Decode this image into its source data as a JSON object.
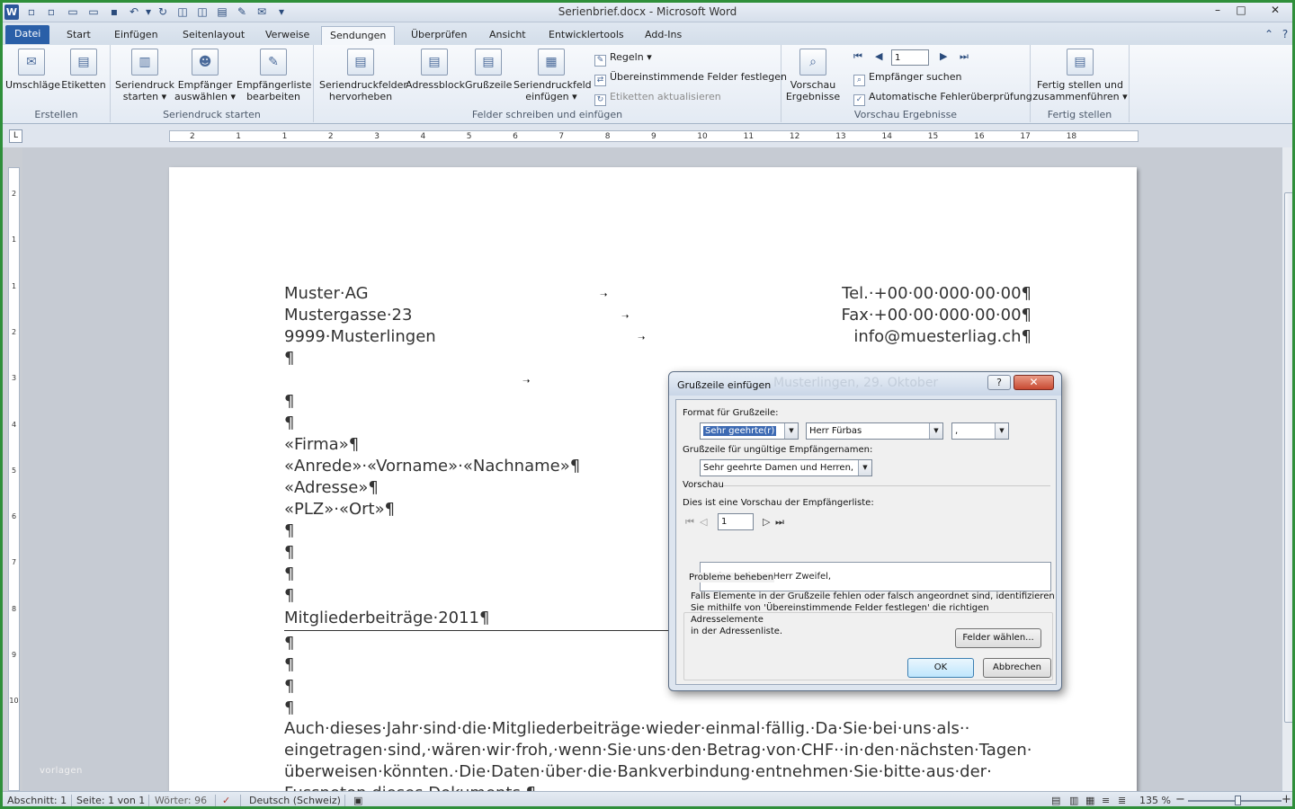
{
  "titlebar": {
    "title": "Serienbrief.docx - Microsoft Word",
    "minimize": "–",
    "maximize": "□",
    "close": "✕"
  },
  "tabs": [
    "Datei",
    "Start",
    "Einfügen",
    "Seitenlayout",
    "Verweise",
    "Sendungen",
    "Überprüfen",
    "Ansicht",
    "Entwicklertools",
    "Add-Ins"
  ],
  "active_tab": "Sendungen",
  "ribbon": {
    "groups": {
      "erstellen": "Erstellen",
      "seriendruck": "Seriendruck starten",
      "felder": "Felder schreiben und einfügen",
      "vorschau": "Vorschau Ergebnisse",
      "fertig": "Fertig stellen"
    },
    "buttons": {
      "umschlaege": "Umschläge",
      "etiketten": "Etiketten",
      "seriendruck_1": "Seriendruck",
      "seriendruck_2": "starten ▾",
      "empfaenger_1": "Empfänger",
      "empfaenger_2": "auswählen ▾",
      "liste_1": "Empfängerliste",
      "liste_2": "bearbeiten",
      "hervor_1": "Seriendruckfelder",
      "hervor_2": "hervorheben",
      "adressblock": "Adressblock",
      "gruss": "Grußzeile",
      "feld_1": "Seriendruckfeld",
      "feld_2": "einfügen ▾",
      "regeln": "Regeln ▾",
      "uebereinstimmende": "Übereinstimmende Felder festlegen",
      "etiketten_akt": "Etiketten aktualisieren",
      "vorschau_1": "Vorschau",
      "vorschau_2": "Ergebnisse",
      "record": "1",
      "empf_suchen": "Empfänger suchen",
      "fehler": "Automatische Fehlerüberprüfung",
      "fertig_1": "Fertig stellen und",
      "fertig_2": "zusammenführen ▾"
    }
  },
  "document": {
    "sender": [
      "Muster·AG",
      "Mustergasse·23",
      "9999·Musterlingen"
    ],
    "contact": [
      "Tel.·+00·00·000·00·00¶",
      "Fax·+00·00·000·00·00¶",
      "info@muesterliag.ch¶"
    ],
    "pilcrow": "¶",
    "fields": [
      "«Firma»¶",
      "«Anrede»·«Vorname»·«Nachname»¶",
      "«Adresse»¶",
      "«PLZ»·«Ort»¶"
    ],
    "subject": "Mitgliederbeiträge·2011¶",
    "body": [
      "Auch·dieses·Jahr·sind·die·Mitgliederbeiträge·wieder·einmal·fällig.·Da·Sie·bei·uns·als··",
      "eingetragen·sind,·wären·wir·froh,·wenn·Sie·uns·den·Betrag·von·CHF··in·den·nächsten·Tagen·",
      "überweisen·könnten.·Die·Daten·über·die·Bankverbindung·entnehmen·Sie·bitte·aus·der·",
      "Fussnoten·dieses·Dokuments.¶"
    ]
  },
  "watermark": "vorlagen",
  "dialog": {
    "title": "Grußzeile einfügen",
    "bg_text": "Musterlingen, 29. Oktober",
    "help": "?",
    "close": "✕",
    "format_label": "Format für Grußzeile:",
    "salutation": "Sehr geehrte(r)",
    "name_format": "Herr Fürbas",
    "punctuation": ",",
    "invalid_label": "Grußzeile für ungültige Empfängernamen:",
    "invalid_value": "Sehr geehrte Damen und Herren,",
    "preview_header": "Vorschau",
    "preview_label": "Dies ist eine Vorschau der Empfängerliste:",
    "preview_record": "1",
    "preview_text": "Sehr geehrter Herr Zweifel,",
    "problems_header": "Probleme beheben",
    "problems_text": "Falls Elemente in der Grußzeile fehlen oder falsch angeordnet sind, identifizieren\nSie mithilfe von 'Übereinstimmende Felder festlegen' die richtigen Adresselemente\nin der Adressenliste.",
    "match_fields": "Felder wählen...",
    "ok": "OK",
    "cancel": "Abbrechen"
  },
  "status": {
    "section": "Abschnitt: 1",
    "page": "Seite: 1 von 1",
    "words": "Wörter: 96",
    "language": "Deutsch (Schweiz)",
    "zoom": "135 %",
    "zoom_minus": "−",
    "zoom_plus": "+"
  },
  "colors": {
    "accent": "#2a5fa8",
    "window_border": "#2f8f3a"
  }
}
